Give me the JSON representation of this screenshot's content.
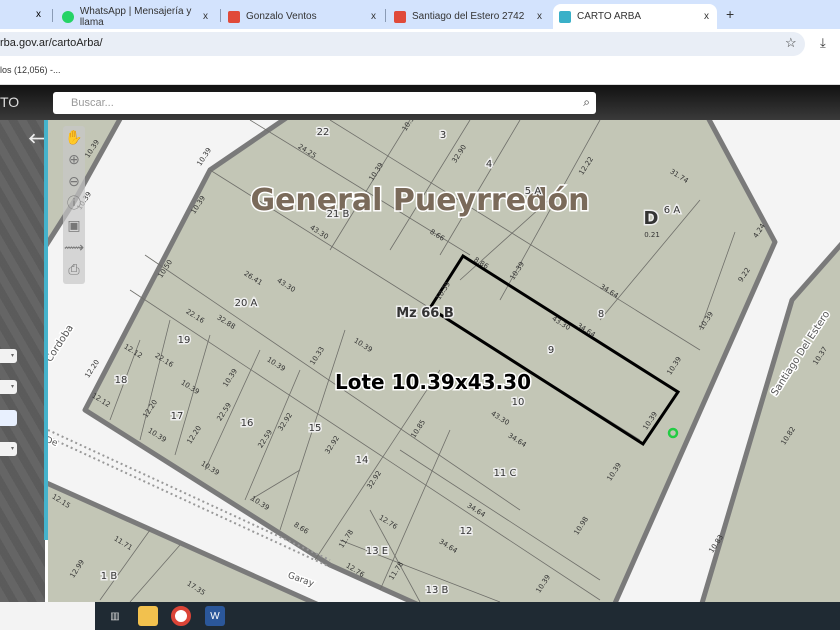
{
  "browser": {
    "tabs": [
      {
        "label": "WhatsApp | Mensajería y llama",
        "icon": "whatsapp-icon"
      },
      {
        "label": "Gonzalo Ventos",
        "icon": "t-icon"
      },
      {
        "label": "Santiago del Estero 2742",
        "icon": "t-icon"
      },
      {
        "label": "CARTO ARBA",
        "icon": "arba-icon",
        "active": true
      }
    ],
    "close": "x",
    "new_tab": "+",
    "url": "rba.gov.ar/cartoArba/",
    "bookmark": "los (12,056) -..."
  },
  "app": {
    "logo": "TO",
    "search_placeholder": "Buscar..."
  },
  "colors": {
    "parcel": "#c3c6b6",
    "street": "#f4f4f4",
    "border": "#7a7a7a",
    "accent": "#45b3cc",
    "highlight": "#000000",
    "marker": "#22cc44"
  },
  "map": {
    "streets": [
      "General Pueyrredón",
      "Cordoba",
      "Santiago Del Estero",
      "Garay",
      "m De"
    ],
    "highlight_label": "Lote 10.39x43.30",
    "lots": [
      "22",
      "3",
      "4",
      "5 A",
      "6 A",
      "D",
      "21 B",
      "20 A",
      "Mz 66 B",
      "8",
      "9",
      "10",
      "11 C",
      "19",
      "18",
      "17",
      "16",
      "15",
      "14",
      "12",
      "13 E",
      "13 B",
      "1 B"
    ],
    "dims": [
      "24.25",
      "43.30",
      "8.66",
      "32.90",
      "12.22",
      "31.74",
      "0.21",
      "4.24",
      "9.22",
      "26.41",
      "43.30",
      "10.50",
      "22.16",
      "32.88",
      "22.16",
      "12.12",
      "12.20",
      "12.12",
      "12.20",
      "10.39",
      "10.39",
      "22.59",
      "12.20",
      "10.39",
      "10.39",
      "10.39",
      "10.33",
      "32.92",
      "22.59",
      "32.92",
      "10.39",
      "32.92",
      "10.85",
      "43.30",
      "34.64",
      "10.39",
      "34.64",
      "43.30",
      "34.64",
      "10.39",
      "8.86",
      "10.39",
      "10.39",
      "10.39",
      "10.39",
      "34.64",
      "34.64",
      "12.76",
      "12.76",
      "11.78",
      "11.78",
      "10.98",
      "10.39",
      "10.39",
      "8.66",
      "12.15",
      "11.71",
      "12.99",
      "17.35",
      "10.39",
      "10.39",
      "10.39",
      "10.39",
      "10.39",
      "10.3",
      "10.82",
      "10.37",
      "10.83"
    ]
  }
}
